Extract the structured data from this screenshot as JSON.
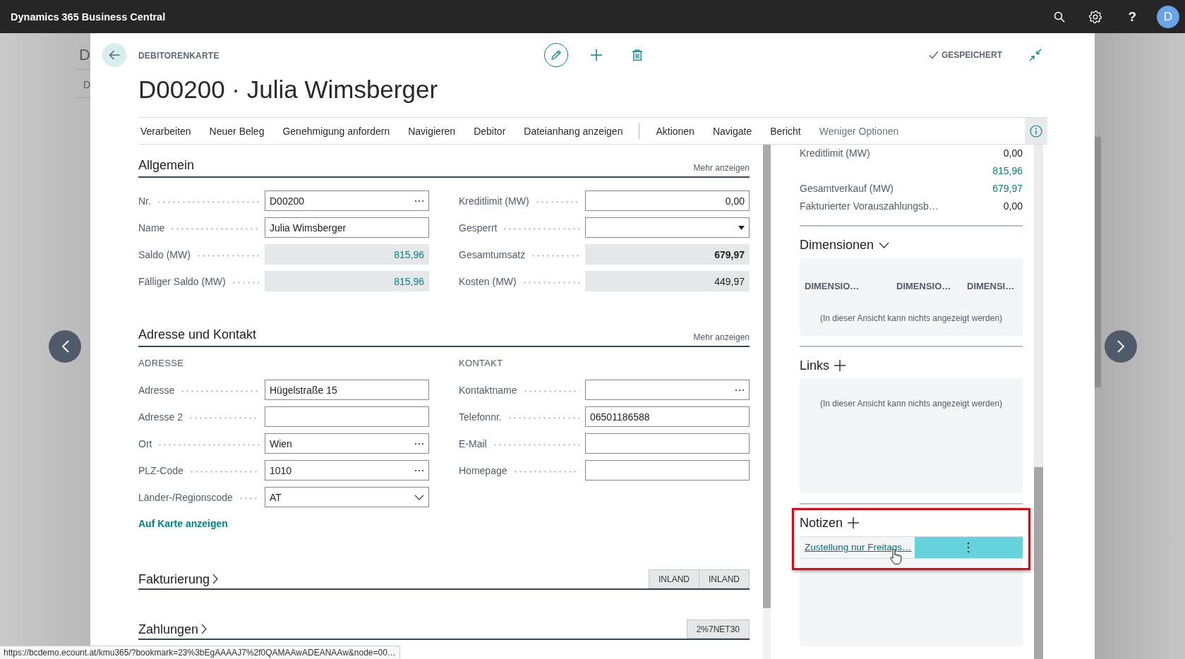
{
  "app_bar": {
    "title": "Dynamics 365 Business Central",
    "help": "?",
    "avatar": "D"
  },
  "background_page": {
    "texts": [
      "D",
      "D"
    ]
  },
  "card": {
    "caption": "DEBITORENKARTE",
    "title": "D00200 · Julia Wimsberger",
    "status": "GESPEICHERT"
  },
  "actions": [
    {
      "label": "Verarbeiten",
      "kind": "promoted"
    },
    {
      "label": "Neuer Beleg",
      "kind": "promoted"
    },
    {
      "label": "Genehmigung anfordern",
      "kind": "promoted"
    },
    {
      "label": "Navigieren",
      "kind": "promoted"
    },
    {
      "label": "Debitor",
      "kind": "promoted"
    },
    {
      "label": "Dateianhang anzeigen",
      "kind": "promoted"
    },
    {
      "label": "Aktionen",
      "kind": "menu"
    },
    {
      "label": "Navigate",
      "kind": "menu"
    },
    {
      "label": "Bericht",
      "kind": "menu"
    },
    {
      "label": "Weniger Optionen",
      "kind": "toggle"
    }
  ],
  "sections": [
    {
      "title": "Allgemein",
      "expanded": true,
      "more": "Mehr anzeigen",
      "columns": [
        {
          "fields": [
            {
              "label": "Nr.",
              "value": "D00200",
              "kind": "lookup"
            },
            {
              "label": "Name",
              "value": "Julia Wimsberger",
              "kind": "text"
            },
            {
              "label": "Saldo (MW)",
              "value": "815,96",
              "kind": "drilldown"
            },
            {
              "label": "Fälliger Saldo (MW)",
              "value": "815,96",
              "kind": "drilldown"
            }
          ]
        },
        {
          "fields": [
            {
              "label": "Kreditlimit (MW)",
              "value": "0,00",
              "kind": "number"
            },
            {
              "label": "Gesperrt",
              "kind": "select"
            },
            {
              "label": "Gesamtumsatz",
              "value": "679,97",
              "kind": "total"
            },
            {
              "label": "Kosten (MW)",
              "value": "449,97",
              "kind": "calculated"
            }
          ]
        }
      ]
    },
    {
      "title": "Adresse und Kontakt",
      "expanded": true,
      "more": "Mehr anzeigen",
      "columns": [
        {
          "heading": "ADRESSE",
          "fields": [
            {
              "label": "Adresse",
              "value": "Hügelstraße 15",
              "kind": "text"
            },
            {
              "label": "Adresse 2",
              "kind": "text"
            },
            {
              "label": "Ort",
              "value": "Wien",
              "kind": "lookup"
            },
            {
              "label": "PLZ-Code",
              "value": "1010",
              "kind": "lookup"
            },
            {
              "label": "Länder-/Regionscode",
              "value": "AT",
              "kind": "combo"
            }
          ]
        },
        {
          "heading": "KONTAKT",
          "fields": [
            {
              "label": "Kontaktname",
              "kind": "lookup"
            },
            {
              "label": "Telefonnr.",
              "value": "06501186588",
              "kind": "text"
            },
            {
              "label": "E-Mail",
              "kind": "text"
            },
            {
              "label": "Homepage",
              "kind": "text"
            }
          ]
        }
      ],
      "link": "Auf Karte anzeigen"
    },
    {
      "title": "Fakturierung",
      "expanded": false,
      "tags": [
        "INLAND",
        "INLAND"
      ]
    },
    {
      "title": "Zahlungen",
      "expanded": false,
      "tags": [
        "2%7NET30"
      ]
    }
  ],
  "factbox": {
    "stats": [
      {
        "label": "Kreditlimit (MW)",
        "value": "0,00",
        "kind": "plain"
      },
      {
        "value": "815,96",
        "kind": "drilldown"
      },
      {
        "label": "Gesamtverkauf (MW)",
        "value": "679,97",
        "kind": "drilldown"
      },
      {
        "label": "Fakturierter Vorauszahlungsb…",
        "value": "0,00",
        "kind": "plain"
      }
    ],
    "parts": [
      {
        "title": "Dimensionen",
        "kind": "expand",
        "columns": [
          "DIMENSIO…",
          "DIMENSIO…",
          "DIMENSI…"
        ],
        "empty": "(In dieser Ansicht kann nichts angezeigt werden)",
        "highlighted": false
      },
      {
        "title": "Links",
        "kind": "add",
        "empty": "(In dieser Ansicht kann nichts angezeigt werden)",
        "highlighted": false
      },
      {
        "title": "Notizen",
        "kind": "add",
        "notes": [
          {
            "text": "Zustellung nur Freitags…",
            "selected": true
          }
        ],
        "highlighted": true
      }
    ]
  },
  "status_url": "https://bcdemo.ecount.at/kmu365/?bookmark=23%3bEgAAAAJ7%2f0QAMAAwADEANAAw&node=00…"
}
